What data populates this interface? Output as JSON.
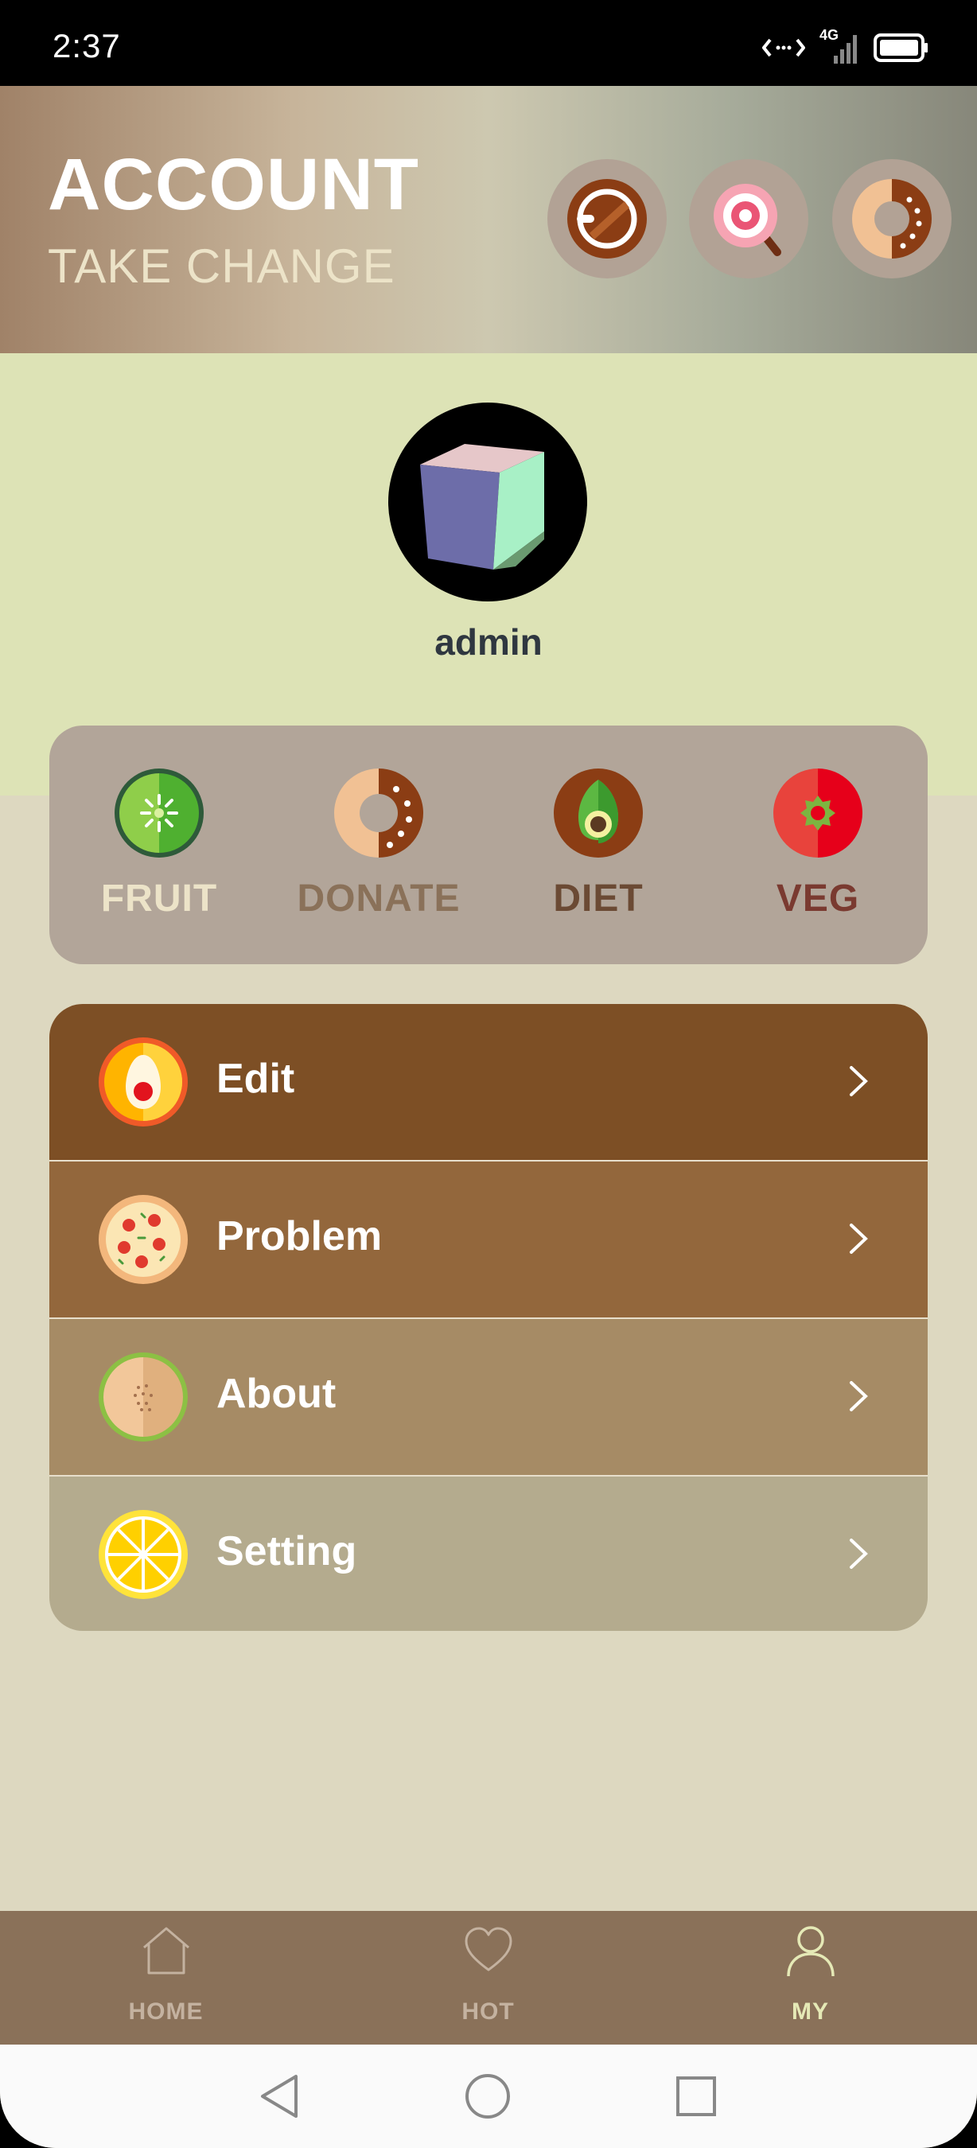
{
  "status": {
    "time": "2:37",
    "network": "4G"
  },
  "header": {
    "title": "ACCOUNT",
    "subtitle": "TAKE CHANGE",
    "icons": [
      "coffee-icon",
      "candy-icon",
      "donut-icon"
    ]
  },
  "profile": {
    "username": "admin"
  },
  "categories": [
    {
      "label": "FRUIT",
      "icon": "kiwi-icon",
      "color": "#ece3c8"
    },
    {
      "label": "DONATE",
      "icon": "donut-icon",
      "color": "#8a7159"
    },
    {
      "label": "DIET",
      "icon": "avocado-icon",
      "color": "#6b4a34"
    },
    {
      "label": "VEG",
      "icon": "tomato-icon",
      "color": "#7a3a30"
    }
  ],
  "menu": [
    {
      "label": "Edit",
      "icon": "egg-icon"
    },
    {
      "label": "Problem",
      "icon": "pizza-icon"
    },
    {
      "label": "About",
      "icon": "melon-icon"
    },
    {
      "label": "Setting",
      "icon": "lemon-icon"
    }
  ],
  "tabs": [
    {
      "label": "HOME",
      "icon": "home-icon",
      "active": false
    },
    {
      "label": "HOT",
      "icon": "heart-icon",
      "active": false
    },
    {
      "label": "MY",
      "icon": "user-icon",
      "active": true
    }
  ],
  "colors": {
    "tab_active": "#e5e9b6",
    "tab_inactive": "#c4b2a0"
  }
}
